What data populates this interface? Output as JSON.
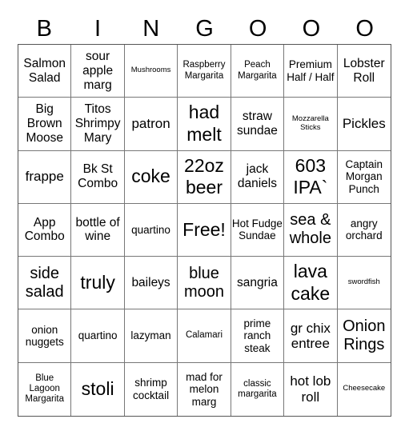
{
  "header": [
    "B",
    "I",
    "N",
    "G",
    "O",
    "O",
    "O"
  ],
  "cells": [
    {
      "text": "Salmon Salad",
      "size": "s15"
    },
    {
      "text": "sour apple marg",
      "size": "s15"
    },
    {
      "text": "Mushrooms",
      "size": "s9"
    },
    {
      "text": "Raspberry Margarita",
      "size": "s11"
    },
    {
      "text": "Peach Margarita",
      "size": "s11"
    },
    {
      "text": "Premium Half / Half",
      "size": "s13"
    },
    {
      "text": "Lobster Roll",
      "size": "s15"
    },
    {
      "text": "Big Brown Moose",
      "size": "s15"
    },
    {
      "text": "Titos Shrimpy Mary",
      "size": "s15"
    },
    {
      "text": "patron",
      "size": "s17"
    },
    {
      "text": "had melt",
      "size": "s23"
    },
    {
      "text": "straw sundae",
      "size": "s15"
    },
    {
      "text": "Mozzarella Sticks",
      "size": "s9"
    },
    {
      "text": "Pickles",
      "size": "s17"
    },
    {
      "text": "frappe",
      "size": "s17"
    },
    {
      "text": "Bk St Combo",
      "size": "s15"
    },
    {
      "text": "coke",
      "size": "s23"
    },
    {
      "text": "22oz beer",
      "size": "s23"
    },
    {
      "text": "jack daniels",
      "size": "s15"
    },
    {
      "text": "603 IPA`",
      "size": "s23"
    },
    {
      "text": "Captain Morgan Punch",
      "size": "s13"
    },
    {
      "text": "App Combo",
      "size": "s15"
    },
    {
      "text": "bottle of wine",
      "size": "s15"
    },
    {
      "text": "quartino",
      "size": "s13"
    },
    {
      "text": "Free!",
      "size": "s23"
    },
    {
      "text": "Hot Fudge Sundae",
      "size": "s13"
    },
    {
      "text": "sea & whole",
      "size": "s20"
    },
    {
      "text": "angry orchard",
      "size": "s13"
    },
    {
      "text": "side salad",
      "size": "s20"
    },
    {
      "text": "truly",
      "size": "s23"
    },
    {
      "text": "baileys",
      "size": "s15"
    },
    {
      "text": "blue moon",
      "size": "s20"
    },
    {
      "text": "sangria",
      "size": "s15"
    },
    {
      "text": "lava cake",
      "size": "s23"
    },
    {
      "text": "swordfish",
      "size": "s9"
    },
    {
      "text": "onion nuggets",
      "size": "s13"
    },
    {
      "text": "quartino",
      "size": "s13"
    },
    {
      "text": "lazyman",
      "size": "s13"
    },
    {
      "text": "Calamari",
      "size": "s11"
    },
    {
      "text": "prime ranch steak",
      "size": "s13"
    },
    {
      "text": "gr chix entree",
      "size": "s17"
    },
    {
      "text": "Onion Rings",
      "size": "s20"
    },
    {
      "text": "Blue Lagoon Margarita",
      "size": "s11"
    },
    {
      "text": "stoli",
      "size": "s23"
    },
    {
      "text": "shrimp cocktail",
      "size": "s13"
    },
    {
      "text": "mad for melon marg",
      "size": "s13"
    },
    {
      "text": "classic margarita",
      "size": "s11"
    },
    {
      "text": "hot lob roll",
      "size": "s17"
    },
    {
      "text": "Cheesecake",
      "size": "s9"
    }
  ]
}
